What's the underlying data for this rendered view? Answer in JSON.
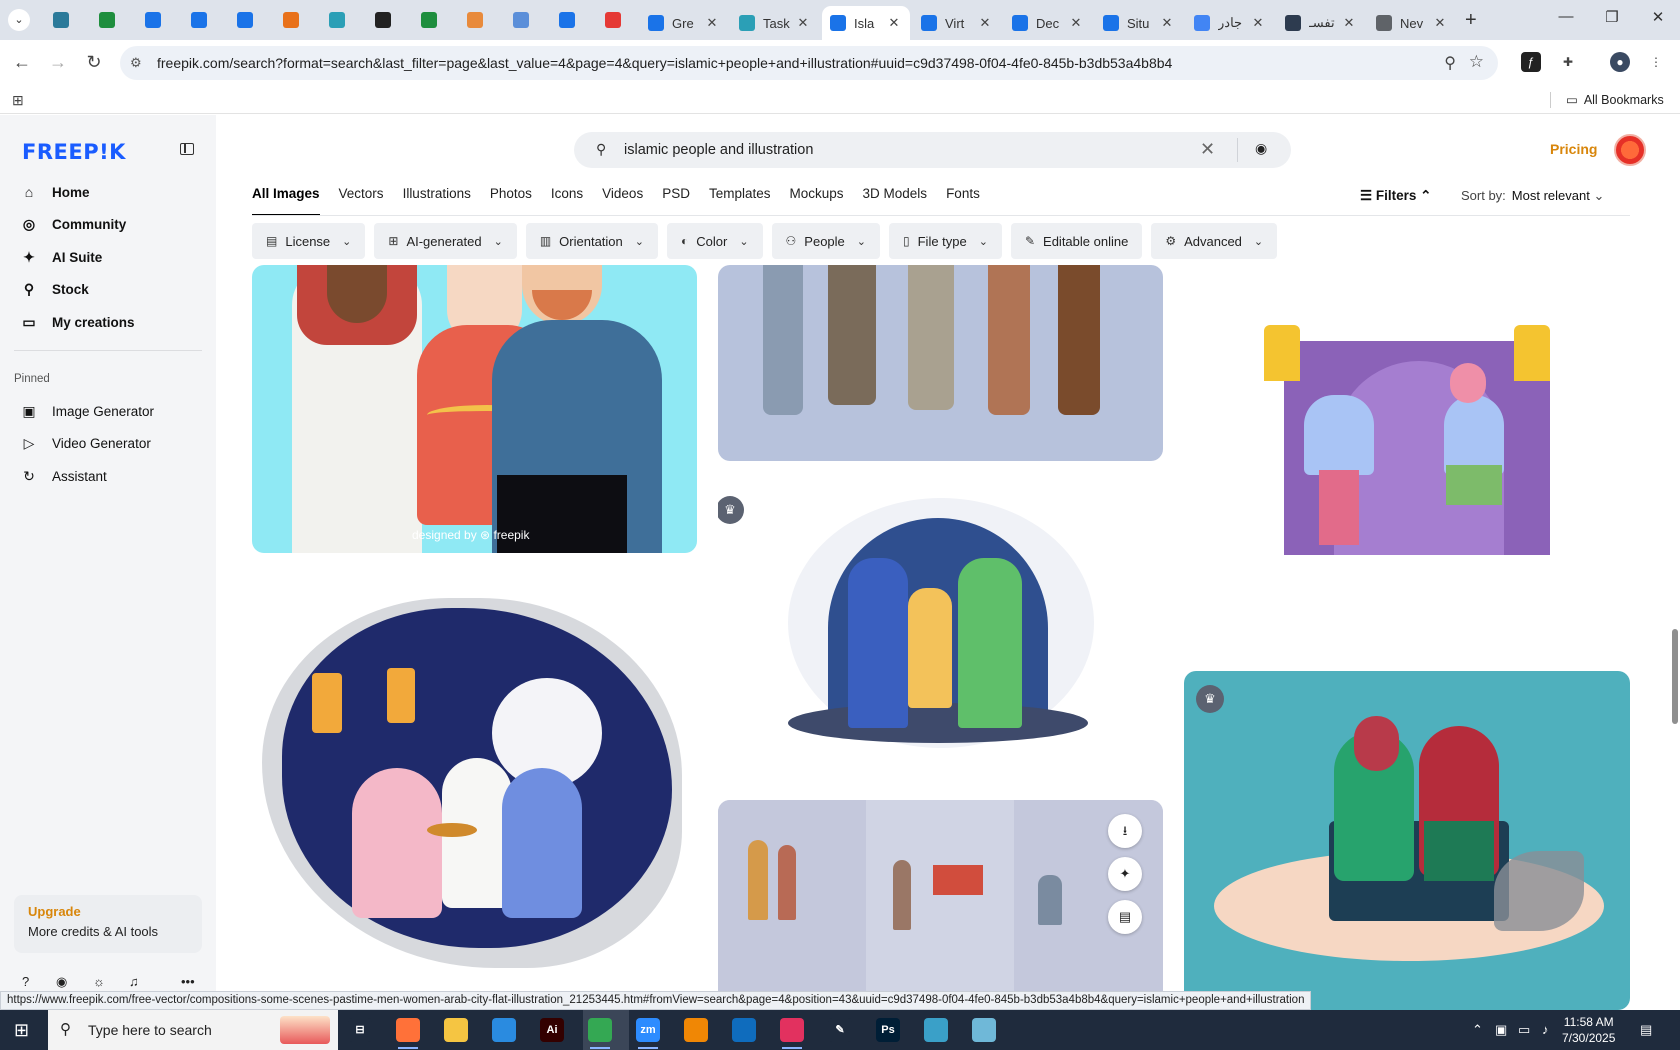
{
  "browser": {
    "tabs": [
      {
        "title": "Gre",
        "color": "#1a73e8"
      },
      {
        "title": "Task",
        "color": "#2b9fb6"
      },
      {
        "title": "Isla",
        "color": "#1a73e8",
        "active": true
      },
      {
        "title": "Virt",
        "color": "#1a73e8"
      },
      {
        "title": "Dec",
        "color": "#1a73e8"
      },
      {
        "title": "Situ",
        "color": "#1a73e8"
      },
      {
        "title": "جادر",
        "color": "#4285f4"
      },
      {
        "title": "تفسـ",
        "color": "#2d3b4f"
      },
      {
        "title": "Nev",
        "color": "#5f6368"
      }
    ],
    "pinned_icons": [
      "pin-vpn-icon",
      "pin-sheets-icon",
      "pin-docs-icon",
      "pin-docs-icon",
      "pin-docs-icon",
      "pin-draw-icon",
      "pin-gem-icon",
      "pin-chatgpt-icon",
      "pin-sheets-icon",
      "pin-hand-icon",
      "pin-app-icon",
      "pin-forms-icon",
      "pin-youtube-icon"
    ],
    "tab_close_glyph": "✕",
    "new_tab_glyph": "+",
    "url": "freepik.com/search?format=search&last_filter=page&last_value=4&page=4&query=islamic+people+and+illustration#uuid=c9d37498-0f04-4fe0-845b-b3db53a4b8b4",
    "all_bookmarks": "All Bookmarks",
    "status_url": "https://www.freepik.com/free-vector/compositions-some-scenes-pastime-men-women-arab-city-flat-illustration_21253445.htm#fromView=search&page=4&position=43&uuid=c9d37498-0f04-4fe0-845b-b3db53a4b8b4&query=islamic+people+and+illustration"
  },
  "sidebar": {
    "logo": "FREEP!K",
    "nav": [
      {
        "label": "Home",
        "icon": "home-icon",
        "glyph": "⌂"
      },
      {
        "label": "Community",
        "icon": "globe-icon",
        "glyph": "◎"
      },
      {
        "label": "AI Suite",
        "icon": "sparkle-icon",
        "glyph": "✦"
      },
      {
        "label": "Stock",
        "icon": "search-icon",
        "glyph": "⚲"
      },
      {
        "label": "My creations",
        "icon": "folder-icon",
        "glyph": "▭"
      }
    ],
    "pinned_label": "Pinned",
    "pinned": [
      {
        "label": "Image Generator",
        "icon": "image-icon",
        "glyph": "▣"
      },
      {
        "label": "Video Generator",
        "icon": "video-icon",
        "glyph": "▷"
      },
      {
        "label": "Assistant",
        "icon": "assistant-icon",
        "glyph": "↻"
      }
    ],
    "upgrade_title": "Upgrade",
    "upgrade_sub": "More credits & AI tools"
  },
  "search": {
    "value": "islamic people and illustration",
    "clear_glyph": "✕",
    "camera_glyph": "◉"
  },
  "header": {
    "pricing": "Pricing"
  },
  "types": [
    "All Images",
    "Vectors",
    "Illustrations",
    "Photos",
    "Icons",
    "Videos",
    "PSD",
    "Templates",
    "Mockups",
    "3D Models",
    "Fonts"
  ],
  "filters_label": "Filters",
  "sort_label": "Sort by:",
  "sort_value": "Most relevant",
  "chips": [
    {
      "label": "License",
      "glyph": "▤"
    },
    {
      "label": "AI-generated",
      "glyph": "⊞"
    },
    {
      "label": "Orientation",
      "glyph": "▥"
    },
    {
      "label": "Color",
      "glyph": "◐"
    },
    {
      "label": "People",
      "glyph": "⚇"
    },
    {
      "label": "File type",
      "glyph": "▯"
    },
    {
      "label": "Editable online",
      "glyph": "✎"
    },
    {
      "label": "Advanced",
      "glyph": "⚙"
    }
  ],
  "watermark": "designed by ⊛ freepik",
  "taskbar": {
    "search_placeholder": "Type here to search",
    "apps": [
      {
        "name": "task-view-icon",
        "label": "⊟",
        "color": "#1f2b3d"
      },
      {
        "name": "firefox-icon",
        "label": "",
        "color": "#ff7139"
      },
      {
        "name": "file-explorer-icon",
        "label": "",
        "color": "#f5c542"
      },
      {
        "name": "vscode-icon",
        "label": "",
        "color": "#2a8be0"
      },
      {
        "name": "illustrator-icon",
        "label": "Ai",
        "color": "#330000"
      },
      {
        "name": "chrome-icon",
        "label": "",
        "color": "#34a853"
      },
      {
        "name": "zoom-icon",
        "label": "zm",
        "color": "#2d8cff"
      },
      {
        "name": "drawio-icon",
        "label": "",
        "color": "#f08705"
      },
      {
        "name": "outlook-icon",
        "label": "",
        "color": "#0f6cbd"
      },
      {
        "name": "creative-cloud-icon",
        "label": "",
        "color": "#e2315f"
      },
      {
        "name": "pen-tool-icon",
        "label": "✎",
        "color": "#1f2b3d"
      },
      {
        "name": "photoshop-icon",
        "label": "Ps",
        "color": "#001e36"
      },
      {
        "name": "vpn-app-icon",
        "label": "",
        "color": "#3aa0c8"
      },
      {
        "name": "notepad-icon",
        "label": "",
        "color": "#6fb8d8"
      }
    ],
    "time": "11:58 AM",
    "date": "7/30/2025"
  }
}
